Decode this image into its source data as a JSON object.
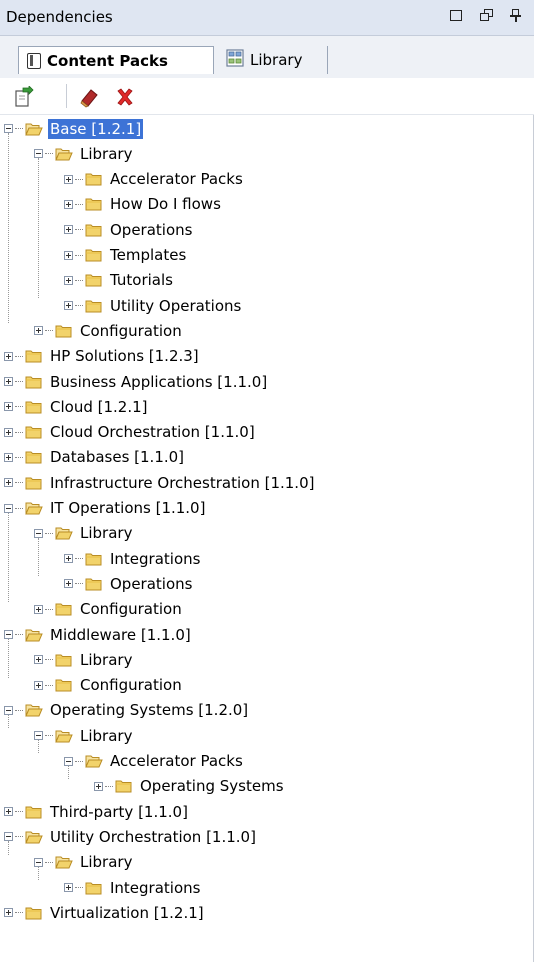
{
  "window": {
    "title": "Dependencies",
    "controls": [
      "maximize",
      "restore",
      "pin"
    ]
  },
  "tabs": [
    {
      "label": "Content Packs",
      "active": true,
      "icon": "content-pack-icon"
    },
    {
      "label": "Library",
      "active": false,
      "icon": "library-icon"
    }
  ],
  "toolbar": {
    "buttons": [
      {
        "name": "import",
        "icon": "import-icon"
      },
      {
        "name": "edit",
        "icon": "eraser-icon"
      },
      {
        "name": "delete",
        "icon": "delete-x-icon"
      }
    ]
  },
  "colors": {
    "titlebar": "#dfe6f2",
    "selection": "#3d73d6",
    "folder": "#f2d36b"
  },
  "tree": [
    {
      "label": "Base [1.2.1]",
      "depth": 0,
      "expanded": true,
      "selected": true,
      "children": [
        {
          "label": "Library",
          "depth": 1,
          "expanded": true,
          "children": [
            {
              "label": "Accelerator Packs",
              "depth": 2
            },
            {
              "label": "How Do I flows",
              "depth": 2
            },
            {
              "label": "Operations",
              "depth": 2
            },
            {
              "label": "Templates",
              "depth": 2
            },
            {
              "label": "Tutorials",
              "depth": 2
            },
            {
              "label": "Utility Operations",
              "depth": 2
            }
          ]
        },
        {
          "label": "Configuration",
          "depth": 1
        }
      ]
    },
    {
      "label": "HP Solutions [1.2.3]",
      "depth": 0
    },
    {
      "label": "Business Applications [1.1.0]",
      "depth": 0
    },
    {
      "label": "Cloud [1.2.1]",
      "depth": 0
    },
    {
      "label": "Cloud Orchestration [1.1.0]",
      "depth": 0
    },
    {
      "label": "Databases [1.1.0]",
      "depth": 0
    },
    {
      "label": "Infrastructure Orchestration [1.1.0]",
      "depth": 0
    },
    {
      "label": "IT Operations [1.1.0]",
      "depth": 0,
      "expanded": true,
      "children": [
        {
          "label": "Library",
          "depth": 1,
          "expanded": true,
          "children": [
            {
              "label": "Integrations",
              "depth": 2
            },
            {
              "label": "Operations",
              "depth": 2
            }
          ]
        },
        {
          "label": "Configuration",
          "depth": 1
        }
      ]
    },
    {
      "label": "Middleware [1.1.0]",
      "depth": 0,
      "expanded": true,
      "children": [
        {
          "label": "Library",
          "depth": 1
        },
        {
          "label": "Configuration",
          "depth": 1
        }
      ]
    },
    {
      "label": "Operating Systems [1.2.0]",
      "depth": 0,
      "expanded": true,
      "children": [
        {
          "label": "Library",
          "depth": 1,
          "expanded": true,
          "children": [
            {
              "label": "Accelerator Packs",
              "depth": 2,
              "expanded": true,
              "children": [
                {
                  "label": "Operating Systems",
                  "depth": 3
                }
              ]
            }
          ]
        }
      ]
    },
    {
      "label": "Third-party [1.1.0]",
      "depth": 0
    },
    {
      "label": "Utility Orchestration [1.1.0]",
      "depth": 0,
      "expanded": true,
      "children": [
        {
          "label": "Library",
          "depth": 1,
          "expanded": true,
          "children": [
            {
              "label": "Integrations",
              "depth": 2
            }
          ]
        }
      ]
    },
    {
      "label": "Virtualization [1.2.1]",
      "depth": 0
    }
  ]
}
